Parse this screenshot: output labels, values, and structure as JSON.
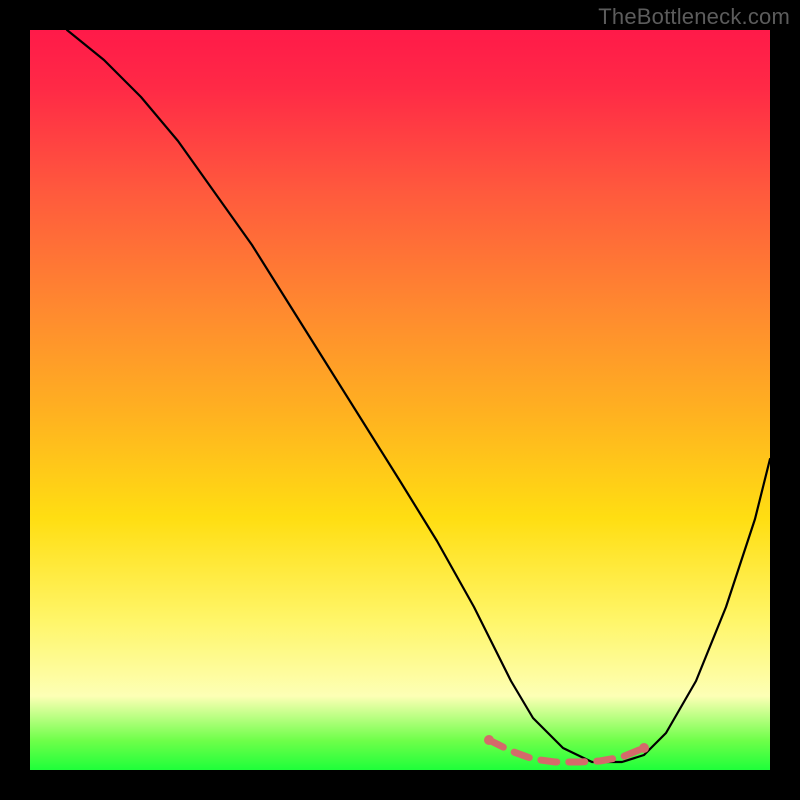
{
  "watermark": "TheBottleneck.com",
  "chart_data": {
    "type": "line",
    "title": "",
    "xlabel": "",
    "ylabel": "",
    "xlim": [
      0,
      100
    ],
    "ylim": [
      0,
      100
    ],
    "grid": false,
    "legend": false,
    "background_gradient_stops": [
      {
        "pos": 0,
        "color": "#ff1a49"
      },
      {
        "pos": 22,
        "color": "#ff5a3d"
      },
      {
        "pos": 52,
        "color": "#ffb220"
      },
      {
        "pos": 80,
        "color": "#fff66a"
      },
      {
        "pos": 96,
        "color": "#6fff4a"
      },
      {
        "pos": 100,
        "color": "#1eff3a"
      }
    ],
    "series": [
      {
        "name": "bottleneck-curve",
        "color": "#000000",
        "x": [
          5,
          10,
          15,
          20,
          25,
          30,
          35,
          40,
          45,
          50,
          55,
          60,
          62,
          65,
          68,
          72,
          76,
          80,
          83,
          86,
          90,
          94,
          98,
          100
        ],
        "y": [
          100,
          96,
          91,
          85,
          78,
          71,
          63,
          55,
          47,
          39,
          31,
          22,
          18,
          12,
          7,
          3,
          1,
          1,
          2,
          5,
          12,
          22,
          34,
          42
        ]
      }
    ],
    "highlight_range": {
      "name": "optimal-zone",
      "color": "#d46a6a",
      "x": [
        62,
        65,
        68,
        71,
        74,
        77,
        80,
        83
      ],
      "y": [
        4,
        2.5,
        1.5,
        1,
        1,
        1.2,
        1.8,
        3
      ]
    }
  }
}
